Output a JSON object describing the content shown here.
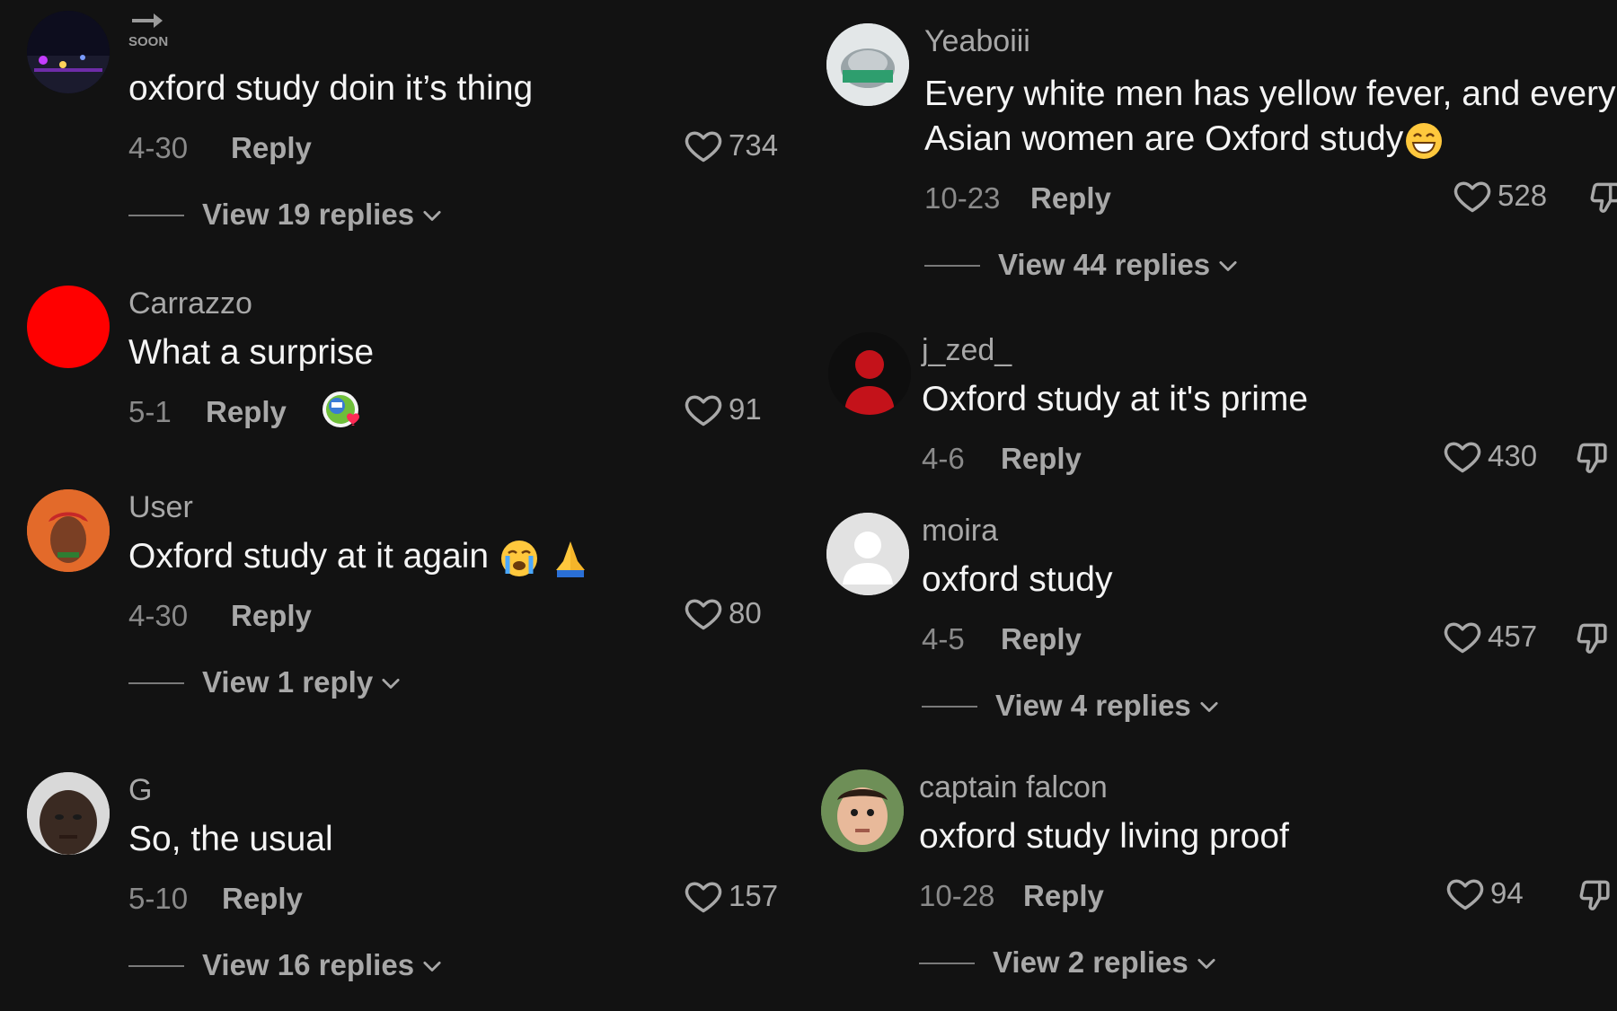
{
  "left": {
    "c1": {
      "badge": "SOON",
      "text": "oxford study doin it’s thing",
      "date": "4-30",
      "reply": "Reply",
      "likes": "734",
      "view": "View 19 replies"
    },
    "c2": {
      "username": "Carrazzo",
      "text": "What a surprise",
      "date": "5-1",
      "reply": "Reply",
      "likes": "91"
    },
    "c3": {
      "username": "User",
      "text": "Oxford study at it again",
      "date": "4-30",
      "reply": "Reply",
      "likes": "80",
      "view": "View 1 reply"
    },
    "c4": {
      "username": "G",
      "text": "So, the usual",
      "date": "5-10",
      "reply": "Reply",
      "likes": "157",
      "view": "View 16 replies"
    }
  },
  "right": {
    "c1": {
      "username": "Yeaboiii",
      "text_line1": "Every white men has yellow fever, and every",
      "text_line2": "Asian women are Oxford study",
      "date": "10-23",
      "reply": "Reply",
      "likes": "528",
      "view": "View 44 replies"
    },
    "c2": {
      "username": "j_zed_",
      "text": "Oxford study at it's prime",
      "date": "4-6",
      "reply": "Reply",
      "likes": "430"
    },
    "c3": {
      "username": "moira",
      "text": "oxford study",
      "date": "4-5",
      "reply": "Reply",
      "likes": "457",
      "view": "View 4 replies"
    },
    "c4": {
      "username": "captain falcon",
      "text": "oxford study living proof",
      "date": "10-28",
      "reply": "Reply",
      "likes": "94",
      "view": "View 2 replies"
    }
  },
  "icons": {
    "like": "heart-outline-icon",
    "dislike": "thumbs-down-icon",
    "expand": "chevron-down-icon"
  }
}
